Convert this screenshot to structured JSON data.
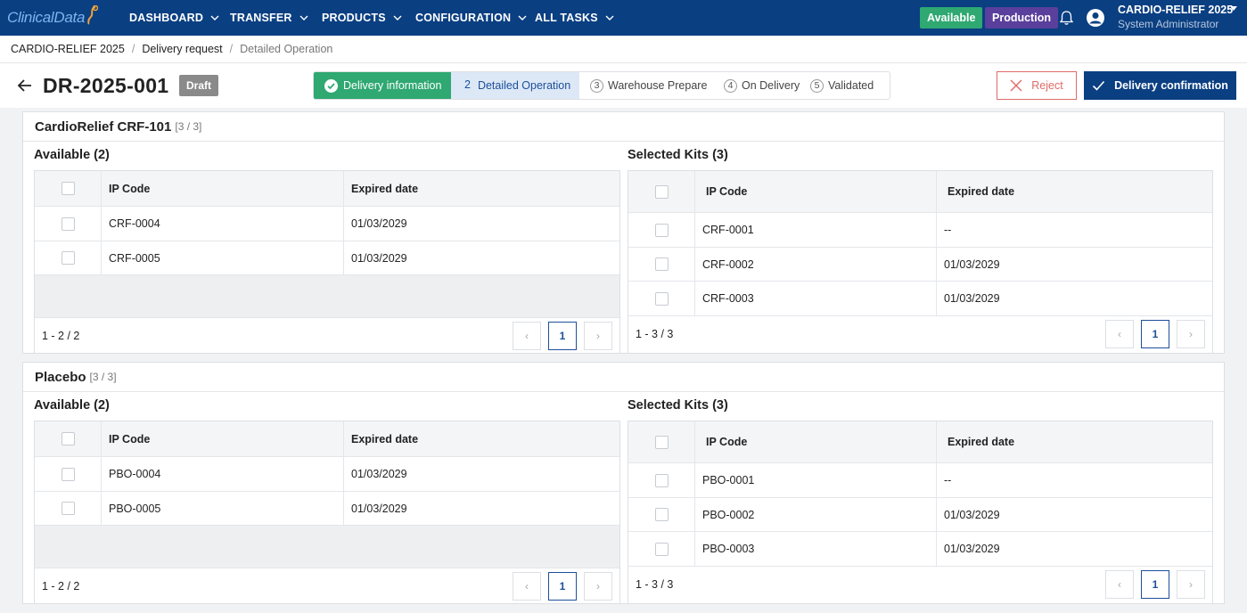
{
  "app": {
    "logo_text": "ClinicalData",
    "nav": [
      {
        "label": "DASHBOARD"
      },
      {
        "label": "TRANSFER"
      },
      {
        "label": "PRODUCTS"
      },
      {
        "label": "CONFIGURATION"
      },
      {
        "label": "ALL TASKS"
      }
    ],
    "status_available": "Available",
    "status_env": "Production",
    "study_name": "CARDIO-RELIEF 2025",
    "user_role": "System Administrator"
  },
  "breadcrumb": [
    "CARDIO-RELIEF 2025",
    "Delivery request",
    "Detailed Operation"
  ],
  "header": {
    "doc_id": "DR-2025-001",
    "status_badge": "Draft",
    "reject_label": "Reject",
    "confirm_label": "Delivery confirmation"
  },
  "steps": [
    {
      "num": "",
      "label": "Delivery information",
      "state": "done"
    },
    {
      "num": "2",
      "label": "Detailed Operation",
      "state": "active"
    },
    {
      "num": "3",
      "label": "Warehouse Prepare",
      "state": "todo"
    },
    {
      "num": "4",
      "label": "On Delivery",
      "state": "todo"
    },
    {
      "num": "5",
      "label": "Validated",
      "state": "todo"
    }
  ],
  "products": [
    {
      "name": "CardioRelief CRF-101",
      "count": "[3 / 3]",
      "available": {
        "title": "Available (2)",
        "col_code": "IP Code",
        "col_date": "Expired date",
        "rows": [
          {
            "code": "CRF-0004",
            "date": "01/03/2029"
          },
          {
            "code": "CRF-0005",
            "date": "01/03/2029"
          }
        ],
        "range": "1 - 2 / 2",
        "page": "1"
      },
      "selected": {
        "title": "Selected Kits (3)",
        "col_code": "IP Code",
        "col_date": "Expired date",
        "rows": [
          {
            "code": "CRF-0001",
            "date": "--"
          },
          {
            "code": "CRF-0002",
            "date": "01/03/2029"
          },
          {
            "code": "CRF-0003",
            "date": "01/03/2029"
          }
        ],
        "range": "1 - 3 / 3",
        "page": "1"
      }
    },
    {
      "name": "Placebo",
      "count": "[3 / 3]",
      "available": {
        "title": "Available (2)",
        "col_code": "IP Code",
        "col_date": "Expired date",
        "rows": [
          {
            "code": "PBO-0004",
            "date": "01/03/2029"
          },
          {
            "code": "PBO-0005",
            "date": "01/03/2029"
          }
        ],
        "range": "1 - 2 / 2",
        "page": "1"
      },
      "selected": {
        "title": "Selected Kits (3)",
        "col_code": "IP Code",
        "col_date": "Expired date",
        "rows": [
          {
            "code": "PBO-0001",
            "date": "--"
          },
          {
            "code": "PBO-0002",
            "date": "01/03/2029"
          },
          {
            "code": "PBO-0003",
            "date": "01/03/2029"
          }
        ],
        "range": "1 - 3 / 3",
        "page": "1"
      }
    }
  ],
  "colors": {
    "nav_bg": "#0a3f82",
    "success": "#2fa872",
    "env": "#5a3f9c",
    "danger": "#e06a6a",
    "active_step": "#dde8f6"
  }
}
